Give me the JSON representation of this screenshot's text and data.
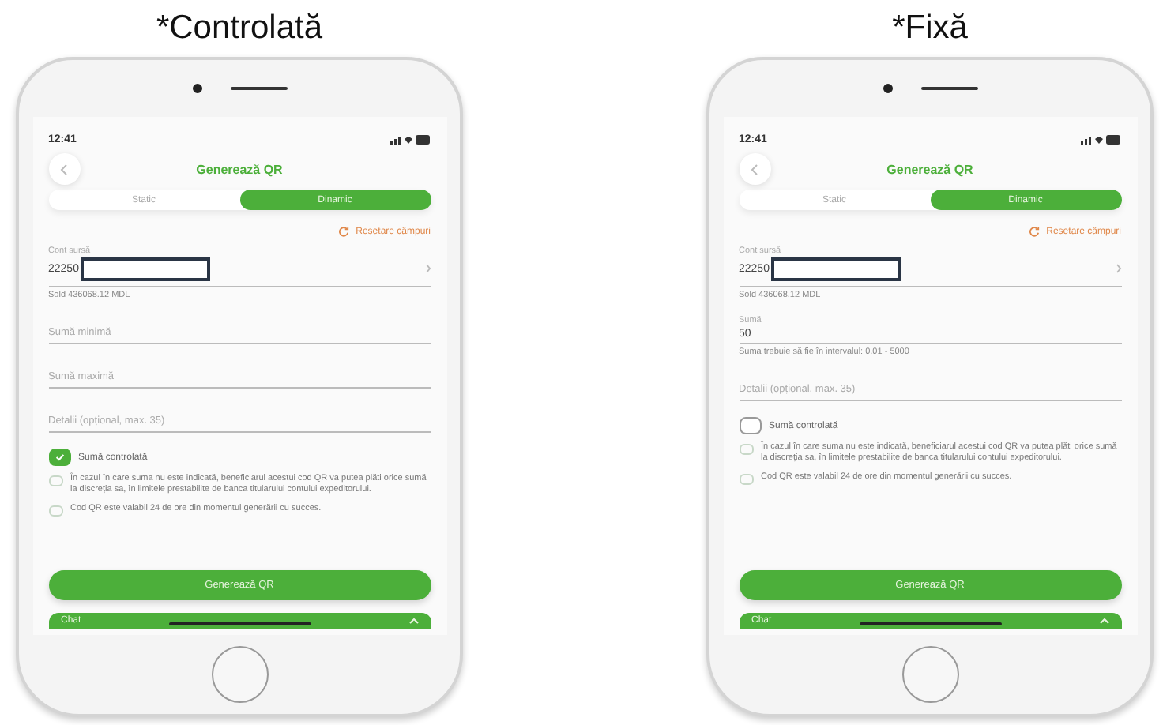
{
  "phones": [
    {
      "caption": "*Controlată",
      "screen": {
        "time": "12:41",
        "title": "Generează QR",
        "tabs": [
          {
            "label": "Static",
            "selected": false
          },
          {
            "label": "Dinamic",
            "selected": true
          }
        ],
        "reset": "Resetare câmpuri",
        "account": {
          "label": "Cont sursă",
          "value": "22250"
        },
        "balance": "Sold 436068.12 MDL",
        "fields": [
          {
            "kind": "input",
            "placeholder": "Sumă minimă"
          },
          {
            "kind": "input",
            "placeholder": "Sumă maximă"
          },
          {
            "kind": "input",
            "placeholder": "Detalii (opțional, max. 35)"
          }
        ],
        "checkbox": {
          "label": "Sumă controlată",
          "checked": true
        },
        "notes": [
          "În cazul în care suma nu este indicată, beneficiarul acestui cod QR va putea plăti orice sumă la discreția sa, în limitele prestabilite de banca titularului contului expeditorului.",
          "Cod QR este valabil 24 de ore din momentul generării cu succes."
        ],
        "button": "Generează QR",
        "chat": "Chat"
      }
    },
    {
      "caption": "*Fixă",
      "screen": {
        "time": "12:41",
        "title": "Generează QR",
        "tabs": [
          {
            "label": "Static",
            "selected": false
          },
          {
            "label": "Dinamic",
            "selected": true
          }
        ],
        "reset": "Resetare câmpuri",
        "account": {
          "label": "Cont sursă",
          "value": "22250"
        },
        "balance": "Sold 436068.12 MDL",
        "fields": [
          {
            "kind": "value",
            "label": "Sumă",
            "value": "50",
            "hint": "Suma trebuie să fie în intervalul: 0.01 - 5000"
          },
          {
            "kind": "input",
            "placeholder": "Detalii (opțional, max. 35)"
          }
        ],
        "checkbox": {
          "label": "Sumă controlată",
          "checked": false
        },
        "notes": [
          "În cazul în care suma nu este indicată, beneficiarul acestui cod QR va putea plăti orice sumă la discreția sa, în limitele prestabilite de banca titularului contului expeditorului.",
          "Cod QR este valabil 24 de ore din momentul generării cu succes."
        ],
        "button": "Generează QR",
        "chat": "Chat"
      }
    }
  ]
}
